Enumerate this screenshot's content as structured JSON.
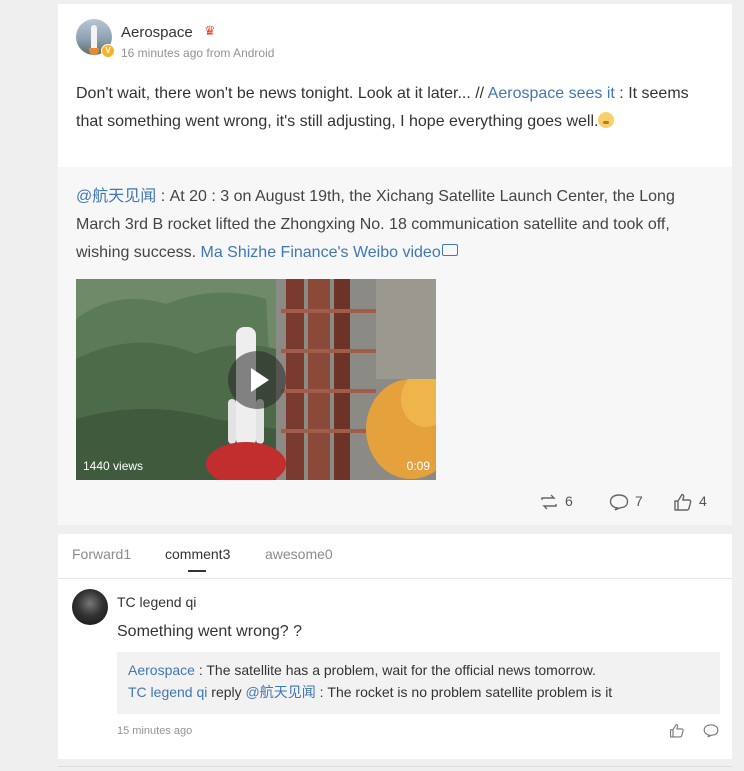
{
  "post": {
    "author": "Aerospace",
    "meta": "16 minutes ago from Android",
    "text_before": "Don't wait, there won't be news tonight. Look at it later... // ",
    "mention": "Aerospace sees it",
    "text_after": " : It seems that something went wrong, it's still adjusting, I hope everything goes well."
  },
  "repost": {
    "mention": "@航天见闻",
    "text": " : At 20 : 3 on August 19th, the Xichang Satellite Launch Center, the Long March 3rd B rocket lifted the Zhongxing No. 18 communication satellite and took off, wishing success. ",
    "video_link": "Ma Shizhe Finance's Weibo video",
    "video": {
      "views": "1440 views",
      "duration": "0:09"
    },
    "actions": {
      "forward_count": "6",
      "comment_count": "7",
      "like_count": "4"
    }
  },
  "tabs": [
    {
      "label": "Forward1"
    },
    {
      "label": "comment3"
    },
    {
      "label": "awesome0"
    }
  ],
  "comment": {
    "author": "TC legend qi",
    "text": "Something went wrong? ?",
    "quote": {
      "line1_name": "Aerospace",
      "line1_text": " : The satellite has a problem, wait for the official news tomorrow.",
      "line2_name": "TC legend qi",
      "line2_reply": " reply ",
      "line2_mention": "@航天见闻",
      "line2_text": " : The rocket is no problem satellite problem is it"
    },
    "time": "15 minutes ago"
  },
  "colors": {
    "link": "#4077b6",
    "background": "#efefef",
    "card": "#ffffff"
  }
}
